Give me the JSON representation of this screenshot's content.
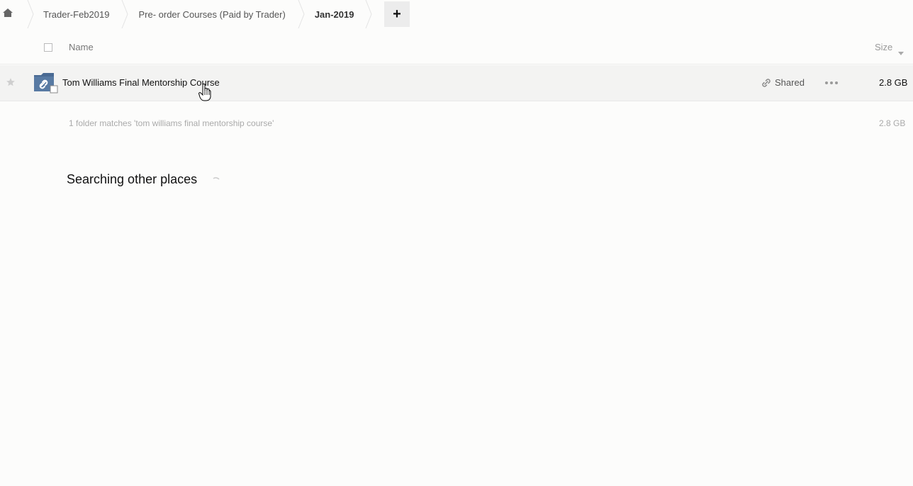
{
  "breadcrumb": {
    "home_icon": "home-icon",
    "items": [
      {
        "label": "Trader-Feb2019"
      },
      {
        "label": "Pre- order Courses (Paid by Trader)"
      },
      {
        "label": "Jan-2019"
      }
    ],
    "add_label": "+"
  },
  "list": {
    "header": {
      "name_label": "Name",
      "size_label": "Size"
    },
    "rows": [
      {
        "name": "Tom Williams Final Mentorship Course",
        "shared_label": "Shared",
        "size": "2.8 GB"
      }
    ],
    "summary": "1 folder matches 'tom williams final mentorship course'",
    "summary_size": "2.8 GB"
  },
  "search": {
    "status": "Searching other places"
  },
  "colors": {
    "folder": "#4a6a93",
    "row_highlight": "#f3f3f2",
    "background": "#fcfcfb"
  }
}
